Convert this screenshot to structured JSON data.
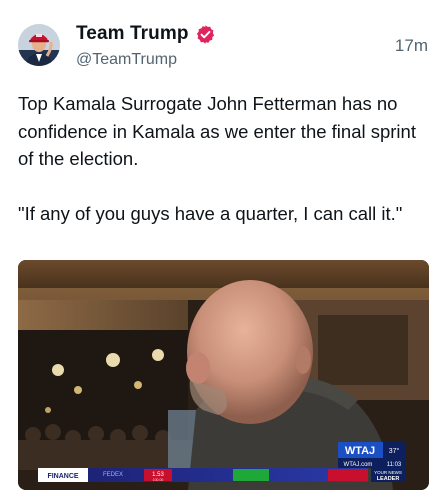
{
  "post": {
    "author": {
      "display_name": "Team Trump",
      "handle": "@TeamTrump",
      "verified_badge_icon": "verified-badge-icon",
      "badge_color": "#e0245e"
    },
    "timestamp": "17m",
    "text": {
      "paragraph_1": "Top Kamala Surrogate John Fetterman has no confidence in Kamala as we enter the final sprint of the election.",
      "paragraph_2": "\"If any of you guys have a quarter, I can call it.\""
    }
  },
  "video_frame": {
    "station_logo": "WTAJ",
    "weather_temp": "37°",
    "website": "WTAJ.com",
    "time": "11:03",
    "news_tag_line_1": "YOUR NEWS",
    "news_tag_line_2": "LEADER",
    "ticker_label": "FINANCE",
    "ticker_symbol": "FEDEX",
    "ticker_value": "1.53",
    "ticker_sub_value": "100.00"
  }
}
